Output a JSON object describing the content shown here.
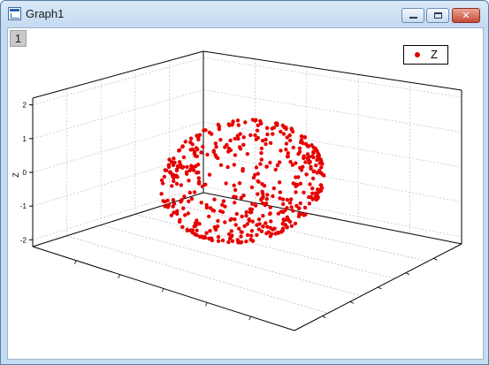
{
  "window": {
    "title": "Graph1",
    "layer_number": "1",
    "controls": {
      "close_glyph": "✕"
    }
  },
  "colors": {
    "series": "#e60000",
    "titlebar": "#c4dcf2"
  },
  "icons": [
    "app-graph-icon",
    "minimize-icon",
    "maximize-icon",
    "close-icon"
  ],
  "chart_data": {
    "type": "scatter",
    "projection": "3d",
    "title": "",
    "zlabel": "Z",
    "zticks": [
      "-2",
      "-1",
      "0",
      "1",
      "2"
    ],
    "zlim": [
      -2.2,
      2.2
    ],
    "grid": true,
    "legend": {
      "position": "top-right",
      "entries": [
        "Z"
      ]
    },
    "series": [
      {
        "name": "Z",
        "color": "#e60000",
        "shape": "sphere",
        "radius": 2,
        "points": 480
      }
    ]
  }
}
